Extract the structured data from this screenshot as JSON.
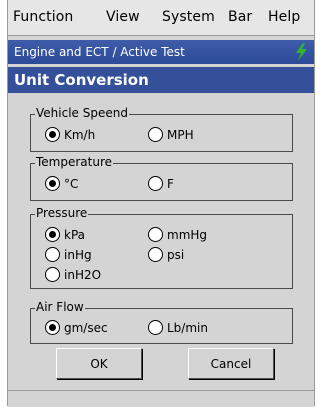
{
  "menubar": {
    "items": [
      "Function",
      "View",
      "System",
      "Bar",
      "Help"
    ]
  },
  "header": {
    "subtitle": "Engine and ECT / Active Test",
    "dialog_title": "Unit Conversion"
  },
  "groups": {
    "vehicle_speed": {
      "label": "Vehicle Speend",
      "options": [
        "Km/h",
        "MPH"
      ],
      "selected": "Km/h"
    },
    "temperature": {
      "label": "Temperature",
      "options": [
        "°C",
        "F"
      ],
      "selected": "°C"
    },
    "pressure": {
      "label": "Pressure",
      "options": [
        "kPa",
        "mmHg",
        "inHg",
        "psi",
        "inH2O"
      ],
      "selected": "kPa"
    },
    "air_flow": {
      "label": "Air Flow",
      "options": [
        "gm/sec",
        "Lb/min"
      ],
      "selected": "gm/sec"
    }
  },
  "buttons": {
    "ok": "OK",
    "cancel": "Cancel"
  },
  "colors": {
    "title_bar": "#34509b",
    "status_icon": "#2fb52f"
  }
}
